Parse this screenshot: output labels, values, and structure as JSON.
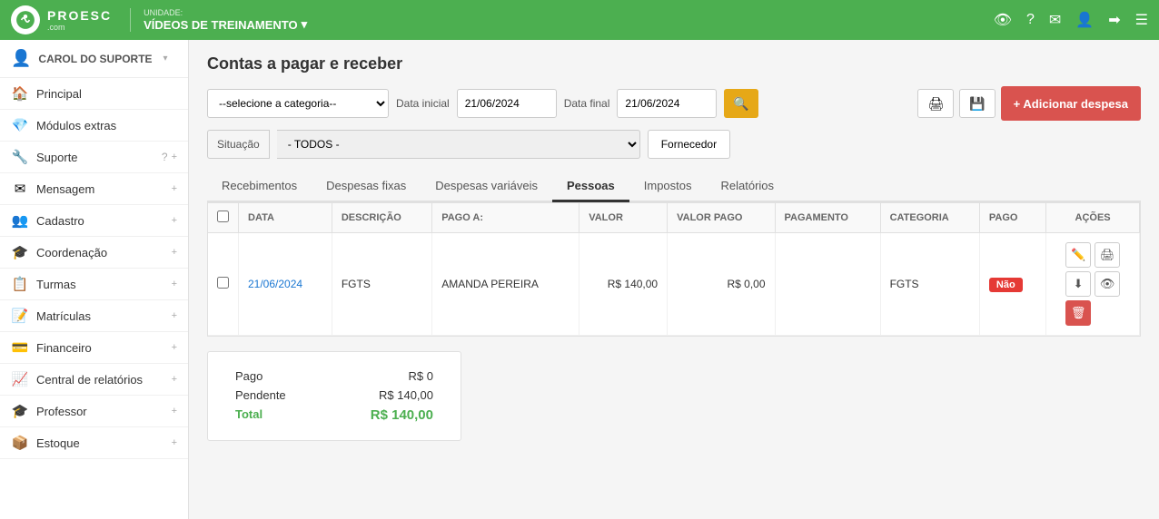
{
  "topnav": {
    "logo_text": "PROESC",
    "logo_subtext": ".com",
    "unit_label": "UNIDADE:",
    "unit_name": "VÍDEOS DE TREINAMENTO",
    "icons": [
      "👁",
      "?",
      "✉",
      "👤",
      "➡",
      "☰"
    ]
  },
  "sidebar": {
    "user_name": "CAROL DO SUPORTE",
    "items": [
      {
        "label": "Principal",
        "icon": "🏠"
      },
      {
        "label": "Módulos extras",
        "icon": "💎"
      },
      {
        "label": "Suporte",
        "icon": "🔧"
      },
      {
        "label": "Mensagem",
        "icon": "✉"
      },
      {
        "label": "Cadastro",
        "icon": "👥"
      },
      {
        "label": "Coordenação",
        "icon": "🎓"
      },
      {
        "label": "Turmas",
        "icon": "📋"
      },
      {
        "label": "Matrículas",
        "icon": "📝"
      },
      {
        "label": "Financeiro",
        "icon": "💳"
      },
      {
        "label": "Central de relatórios",
        "icon": "📈"
      },
      {
        "label": "Professor",
        "icon": "🎓"
      },
      {
        "label": "Estoque",
        "icon": "📦"
      }
    ]
  },
  "page": {
    "title": "Contas a pagar e receber"
  },
  "filters": {
    "category_placeholder": "--selecione a categoria--",
    "date_initial_label": "Data inicial",
    "date_initial_value": "21/06/2024",
    "date_final_label": "Data final",
    "date_final_value": "21/06/2024",
    "situation_label": "Situação",
    "situation_value": "- TODOS -",
    "fornecedor_label": "Fornecedor",
    "add_despesa_label": "+ Adicionar despesa"
  },
  "tabs": [
    {
      "label": "Recebimentos",
      "active": false
    },
    {
      "label": "Despesas fixas",
      "active": false
    },
    {
      "label": "Despesas variáveis",
      "active": false
    },
    {
      "label": "Pessoas",
      "active": true
    },
    {
      "label": "Impostos",
      "active": false
    },
    {
      "label": "Relatórios",
      "active": false
    }
  ],
  "table": {
    "columns": [
      "",
      "DATA",
      "DESCRIÇÃO",
      "PAGO A:",
      "VALOR",
      "VALOR PAGO",
      "PAGAMENTO",
      "CATEGORIA",
      "PAGO",
      "AÇÕES"
    ],
    "rows": [
      {
        "data": "21/06/2024",
        "descricao": "FGTS",
        "pago_a": "AMANDA PEREIRA",
        "valor": "R$ 140,00",
        "valor_pago": "R$ 0,00",
        "pagamento": "",
        "categoria": "FGTS",
        "pago": "Não"
      }
    ]
  },
  "summary": {
    "pago_label": "Pago",
    "pago_value": "R$ 0",
    "pendente_label": "Pendente",
    "pendente_value": "R$ 140,00",
    "total_label": "Total",
    "total_value": "R$ 140,00"
  }
}
